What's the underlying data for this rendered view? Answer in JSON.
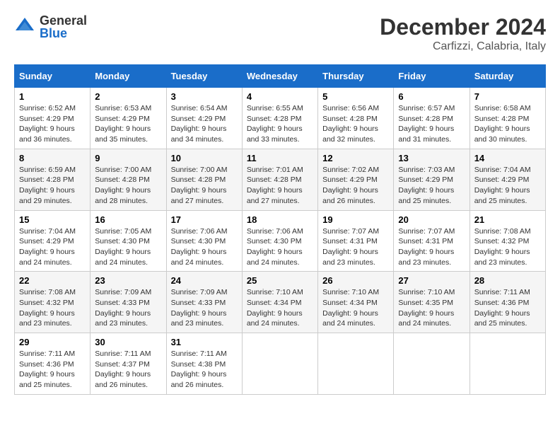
{
  "logo": {
    "general": "General",
    "blue": "Blue"
  },
  "header": {
    "month": "December 2024",
    "location": "Carfizzi, Calabria, Italy"
  },
  "weekdays": [
    "Sunday",
    "Monday",
    "Tuesday",
    "Wednesday",
    "Thursday",
    "Friday",
    "Saturday"
  ],
  "weeks": [
    [
      {
        "day": 1,
        "sunrise": "6:52 AM",
        "sunset": "4:29 PM",
        "daylight": "9 hours and 36 minutes."
      },
      {
        "day": 2,
        "sunrise": "6:53 AM",
        "sunset": "4:29 PM",
        "daylight": "9 hours and 35 minutes."
      },
      {
        "day": 3,
        "sunrise": "6:54 AM",
        "sunset": "4:29 PM",
        "daylight": "9 hours and 34 minutes."
      },
      {
        "day": 4,
        "sunrise": "6:55 AM",
        "sunset": "4:28 PM",
        "daylight": "9 hours and 33 minutes."
      },
      {
        "day": 5,
        "sunrise": "6:56 AM",
        "sunset": "4:28 PM",
        "daylight": "9 hours and 32 minutes."
      },
      {
        "day": 6,
        "sunrise": "6:57 AM",
        "sunset": "4:28 PM",
        "daylight": "9 hours and 31 minutes."
      },
      {
        "day": 7,
        "sunrise": "6:58 AM",
        "sunset": "4:28 PM",
        "daylight": "9 hours and 30 minutes."
      }
    ],
    [
      {
        "day": 8,
        "sunrise": "6:59 AM",
        "sunset": "4:28 PM",
        "daylight": "9 hours and 29 minutes."
      },
      {
        "day": 9,
        "sunrise": "7:00 AM",
        "sunset": "4:28 PM",
        "daylight": "9 hours and 28 minutes."
      },
      {
        "day": 10,
        "sunrise": "7:00 AM",
        "sunset": "4:28 PM",
        "daylight": "9 hours and 27 minutes."
      },
      {
        "day": 11,
        "sunrise": "7:01 AM",
        "sunset": "4:28 PM",
        "daylight": "9 hours and 27 minutes."
      },
      {
        "day": 12,
        "sunrise": "7:02 AM",
        "sunset": "4:29 PM",
        "daylight": "9 hours and 26 minutes."
      },
      {
        "day": 13,
        "sunrise": "7:03 AM",
        "sunset": "4:29 PM",
        "daylight": "9 hours and 25 minutes."
      },
      {
        "day": 14,
        "sunrise": "7:04 AM",
        "sunset": "4:29 PM",
        "daylight": "9 hours and 25 minutes."
      }
    ],
    [
      {
        "day": 15,
        "sunrise": "7:04 AM",
        "sunset": "4:29 PM",
        "daylight": "9 hours and 24 minutes."
      },
      {
        "day": 16,
        "sunrise": "7:05 AM",
        "sunset": "4:30 PM",
        "daylight": "9 hours and 24 minutes."
      },
      {
        "day": 17,
        "sunrise": "7:06 AM",
        "sunset": "4:30 PM",
        "daylight": "9 hours and 24 minutes."
      },
      {
        "day": 18,
        "sunrise": "7:06 AM",
        "sunset": "4:30 PM",
        "daylight": "9 hours and 24 minutes."
      },
      {
        "day": 19,
        "sunrise": "7:07 AM",
        "sunset": "4:31 PM",
        "daylight": "9 hours and 23 minutes."
      },
      {
        "day": 20,
        "sunrise": "7:07 AM",
        "sunset": "4:31 PM",
        "daylight": "9 hours and 23 minutes."
      },
      {
        "day": 21,
        "sunrise": "7:08 AM",
        "sunset": "4:32 PM",
        "daylight": "9 hours and 23 minutes."
      }
    ],
    [
      {
        "day": 22,
        "sunrise": "7:08 AM",
        "sunset": "4:32 PM",
        "daylight": "9 hours and 23 minutes."
      },
      {
        "day": 23,
        "sunrise": "7:09 AM",
        "sunset": "4:33 PM",
        "daylight": "9 hours and 23 minutes."
      },
      {
        "day": 24,
        "sunrise": "7:09 AM",
        "sunset": "4:33 PM",
        "daylight": "9 hours and 23 minutes."
      },
      {
        "day": 25,
        "sunrise": "7:10 AM",
        "sunset": "4:34 PM",
        "daylight": "9 hours and 24 minutes."
      },
      {
        "day": 26,
        "sunrise": "7:10 AM",
        "sunset": "4:34 PM",
        "daylight": "9 hours and 24 minutes."
      },
      {
        "day": 27,
        "sunrise": "7:10 AM",
        "sunset": "4:35 PM",
        "daylight": "9 hours and 24 minutes."
      },
      {
        "day": 28,
        "sunrise": "7:11 AM",
        "sunset": "4:36 PM",
        "daylight": "9 hours and 25 minutes."
      }
    ],
    [
      {
        "day": 29,
        "sunrise": "7:11 AM",
        "sunset": "4:36 PM",
        "daylight": "9 hours and 25 minutes."
      },
      {
        "day": 30,
        "sunrise": "7:11 AM",
        "sunset": "4:37 PM",
        "daylight": "9 hours and 26 minutes."
      },
      {
        "day": 31,
        "sunrise": "7:11 AM",
        "sunset": "4:38 PM",
        "daylight": "9 hours and 26 minutes."
      },
      null,
      null,
      null,
      null
    ]
  ]
}
